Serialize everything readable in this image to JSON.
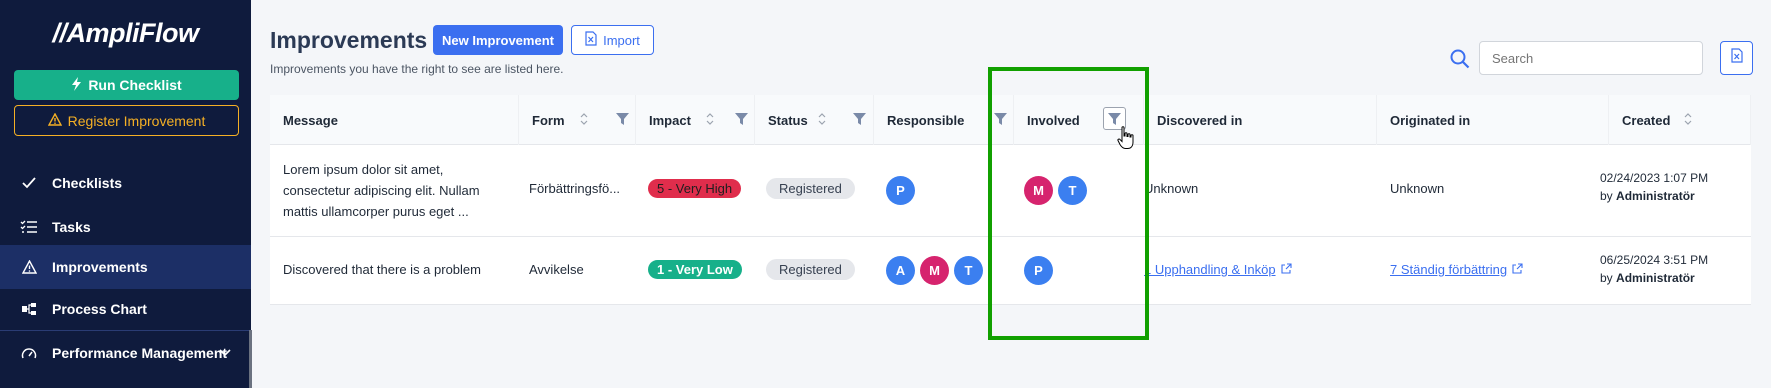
{
  "sidebar": {
    "logo": "//AmpliFlow",
    "run_checklist": "Run Checklist",
    "register_improvement": "Register Improvement",
    "items": [
      {
        "label": "Checklists",
        "icon": "check-icon"
      },
      {
        "label": "Tasks",
        "icon": "list-check-icon"
      },
      {
        "label": "Improvements",
        "icon": "warning-triangle-icon",
        "active": true
      },
      {
        "label": "Process Chart",
        "icon": "flow-chart-icon"
      },
      {
        "label": "Performance Management",
        "icon": "gauge-icon"
      }
    ]
  },
  "header": {
    "title": "Improvements",
    "new_button": "New Improvement",
    "import_button": "Import",
    "subtitle": "Improvements you have the right to see are listed here.",
    "search_placeholder": "Search"
  },
  "table": {
    "columns": [
      "Message",
      "Form",
      "Impact",
      "Status",
      "Responsible",
      "Involved",
      "Discovered in",
      "Originated in",
      "Created"
    ],
    "rows": [
      {
        "message_lines": [
          "Lorem ipsum dolor sit amet,",
          "consectetur adipiscing elit. Nullam",
          "mattis ullamcorper purus eget ..."
        ],
        "form": "Förbättringsfö...",
        "impact": "5 - Very High",
        "status": "Registered",
        "responsible": [
          "P"
        ],
        "involved": [
          "M",
          "T"
        ],
        "discovered_in": "Unknown",
        "originated_in": "Unknown",
        "created_date": "02/24/2023 1:07 PM",
        "created_by_prefix": "by",
        "created_by": "Administratör"
      },
      {
        "message_lines": [
          "Discovered that there is a problem"
        ],
        "form": "Avvikelse",
        "impact": "1 - Very Low",
        "status": "Registered",
        "responsible": [
          "A",
          "M",
          "T"
        ],
        "involved": [
          "P"
        ],
        "discovered_in": "1 Upphandling & Inköp",
        "originated_in": "7 Ständig förbättring",
        "created_date": "06/25/2024 3:51 PM",
        "created_by_prefix": "by",
        "created_by": "Administratör"
      }
    ]
  },
  "colors": {
    "sidebar_bg": "#0f1b3d",
    "active_nav": "#1c2f66",
    "primary": "#3b6ff0",
    "success": "#17b08a",
    "warning": "#f5b025",
    "danger": "#e02d4c",
    "highlight": "#11a000",
    "avatar_blue": "#3b7ff0",
    "avatar_pink": "#d6246e"
  }
}
